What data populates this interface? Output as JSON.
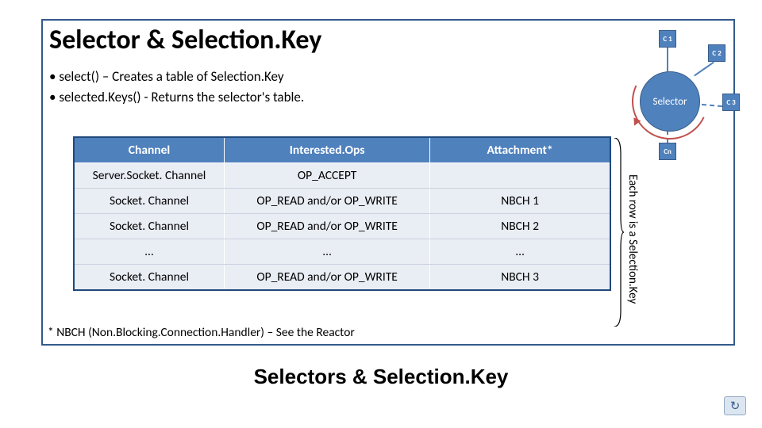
{
  "title": "Selector & Selection.Key",
  "bullets": [
    "select() – Creates a table of Selection.Key",
    "selected.Keys() - Returns the selector's table."
  ],
  "diagram": {
    "center": "Selector",
    "c1": "C 1",
    "c2": "C 2",
    "c3": "C 3",
    "cn": "Cn"
  },
  "table": {
    "headers": {
      "channel": "Channel",
      "ops": "Interested.Ops",
      "attach": "Attachment*"
    },
    "rows": [
      {
        "channel": "Server.Socket. Channel",
        "ops": "OP_ACCEPT",
        "attach": ""
      },
      {
        "channel": "Socket. Channel",
        "ops": "OP_READ and/or OP_WRITE",
        "attach": "NBCH 1"
      },
      {
        "channel": "Socket. Channel",
        "ops": "OP_READ and/or OP_WRITE",
        "attach": "NBCH 2"
      },
      {
        "channel": "…",
        "ops": "…",
        "attach": "…"
      },
      {
        "channel": "Socket. Channel",
        "ops": "OP_READ and/or OP_WRITE",
        "attach": "NBCH 3"
      }
    ]
  },
  "side_label": "Each row is a Selection.Key",
  "footnote": "* NBCH (Non.Blocking.Connection.Handler) – See the Reactor",
  "big_title": "Selectors & Selection.Key",
  "corner_icon_glyph": "↻"
}
